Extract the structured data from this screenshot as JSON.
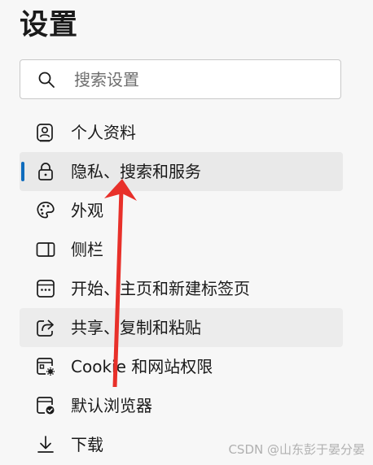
{
  "page": {
    "title": "设置"
  },
  "search": {
    "placeholder": "搜索设置",
    "icon": "search-icon"
  },
  "nav": {
    "items": [
      {
        "label": "个人资料",
        "icon": "profile-icon"
      },
      {
        "label": "隐私、搜索和服务",
        "icon": "lock-icon",
        "selected": true
      },
      {
        "label": "外观",
        "icon": "palette-icon"
      },
      {
        "label": "侧栏",
        "icon": "sidebar-icon"
      },
      {
        "label": "开始、主页和新建标签页",
        "icon": "home-tab-icon"
      },
      {
        "label": "共享、复制和粘贴",
        "icon": "share-icon",
        "hovered": true
      },
      {
        "label": "Cookie 和网站权限",
        "icon": "cookie-site-icon"
      },
      {
        "label": "默认浏览器",
        "icon": "default-browser-icon"
      },
      {
        "label": "下载",
        "icon": "download-icon"
      }
    ]
  },
  "colors": {
    "accent": "#0f6cbd",
    "annotation_arrow": "#e8302a",
    "selected_bg": "#e9e9e9"
  },
  "watermark": "CSDN @山东彭于晏分晏"
}
